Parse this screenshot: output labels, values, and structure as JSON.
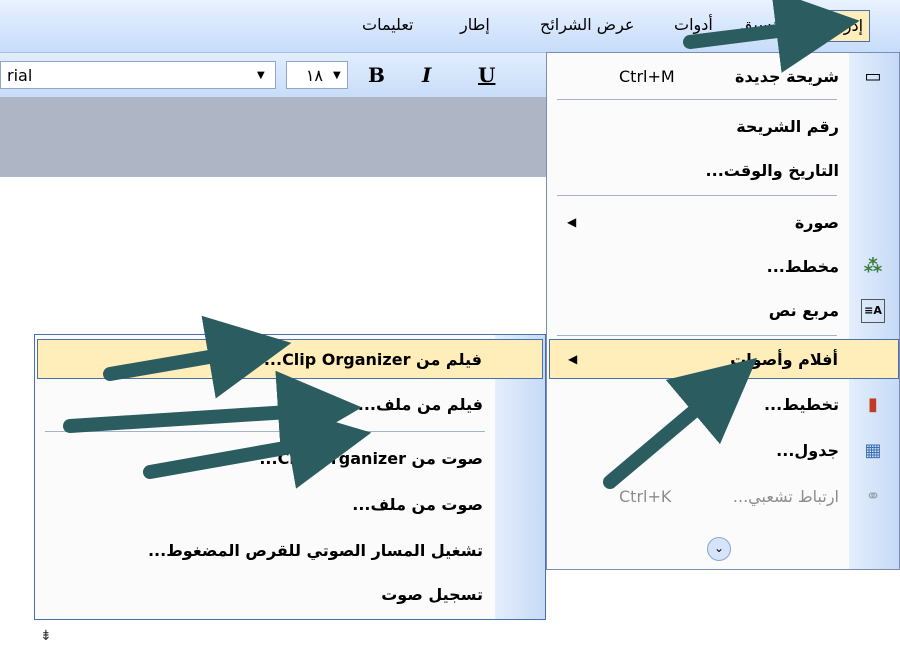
{
  "menubar": {
    "items": [
      {
        "label": "إدراج",
        "active": true
      },
      {
        "label": "تنسيق"
      },
      {
        "label": "أدوات"
      },
      {
        "label": "عرض الشرائح"
      },
      {
        "label": "إطار"
      },
      {
        "label": "تعليمات"
      }
    ]
  },
  "toolbar": {
    "font_name": "rial",
    "font_size": "١٨",
    "bold": "B",
    "italic": "I",
    "underline": "U"
  },
  "insert_menu": {
    "items": [
      {
        "label": "شريحة جديدة",
        "shortcut": "Ctrl+M",
        "icon": "new-slide-icon"
      },
      {
        "label": "رقم الشريحة"
      },
      {
        "label": "التاريخ والوقت..."
      },
      {
        "label": "صورة",
        "submenu": true
      },
      {
        "label": "مخطط...",
        "icon": "diagram-icon"
      },
      {
        "label": "مربع نص",
        "icon": "textbox-icon"
      },
      {
        "label": "أفلام وأصوات",
        "submenu": true,
        "highlighted": true
      },
      {
        "label": "تخطيط...",
        "icon": "chart-icon"
      },
      {
        "label": "جدول...",
        "icon": "table-icon"
      },
      {
        "label": "ارتباط تشعبي...",
        "shortcut": "Ctrl+K",
        "icon": "hyperlink-icon",
        "disabled": true
      }
    ],
    "expand_glyph": "⌄"
  },
  "movies_sounds_submenu": {
    "items": [
      {
        "label": "فيلم من Clip Organizer...",
        "highlighted": true
      },
      {
        "label": "فيلم من ملف..."
      },
      {
        "label": "صوت من Clip Organizer..."
      },
      {
        "label": "صوت من ملف..."
      },
      {
        "label": "تشغيل المسار الصوتي للقرص المضغوط..."
      },
      {
        "label": "تسجيل صوت"
      }
    ]
  },
  "colors": {
    "highlight": "#ffeeb9",
    "menu_border": "#4b6fa8",
    "arrow": "#2b5d60"
  }
}
